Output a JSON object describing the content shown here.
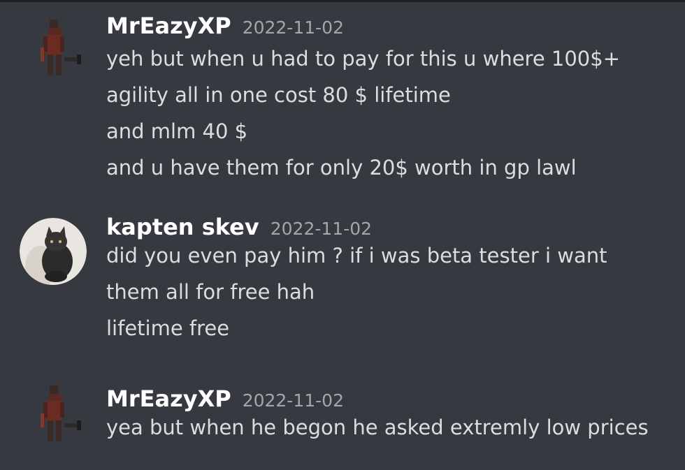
{
  "messages": [
    {
      "username": "MrEazyXP",
      "timestamp": "2022-11-02",
      "avatar": "armored-warrior-avatar",
      "lines": [
        "yeh but when u had to pay for this u where 100$+",
        "agility all in one cost 80 $ lifetime",
        "and mlm 40 $",
        "and u have them for only 20$ worth in gp lawl"
      ]
    },
    {
      "username": "kapten skev",
      "timestamp": "2022-11-02",
      "avatar": "cat-avatar",
      "lines": [
        "did you even pay him ? if i was beta tester i want",
        "them all for free hah",
        "lifetime free"
      ]
    },
    {
      "username": "MrEazyXP",
      "timestamp": "2022-11-02",
      "avatar": "armored-warrior-avatar",
      "lines": [
        "yea but when he begon he asked extremly low prices"
      ]
    }
  ]
}
